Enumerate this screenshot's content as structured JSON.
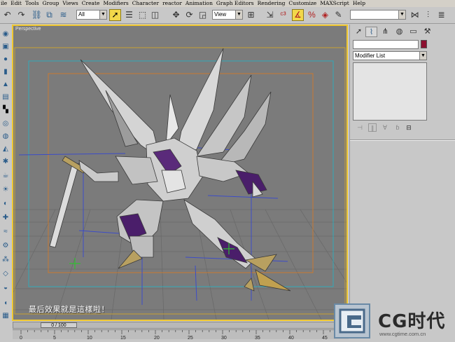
{
  "menubar": {
    "items": [
      "ile",
      "Edit",
      "Tools",
      "Group",
      "Views",
      "Create",
      "Modifiers",
      "Character",
      "reactor",
      "Animation",
      "Graph Editors",
      "Rendering",
      "Customize",
      "MAXScript",
      "Help"
    ]
  },
  "toolbar": {
    "selection_filter": "All",
    "reference_coord": "View",
    "named_selection": ""
  },
  "viewport": {
    "label": "Perspective",
    "caption": "最后效果就是這樣啦！"
  },
  "command_panel": {
    "object_name": "",
    "object_color": "#8c1030",
    "modifier_list_label": "Modifier List"
  },
  "timeline": {
    "frame_readout": "0 / 100",
    "tick_labels": [
      "0",
      "5",
      "10",
      "15",
      "20",
      "25",
      "30",
      "35",
      "40",
      "45"
    ]
  },
  "watermark": {
    "brand": "CG时代",
    "url": "www.cgtime.com.cn"
  },
  "colors": {
    "viewport_bg": "#7b7b7b",
    "active_border": "#f0c830",
    "safe_frame": "#c8a030",
    "outer_safe": "#30a8b8"
  }
}
